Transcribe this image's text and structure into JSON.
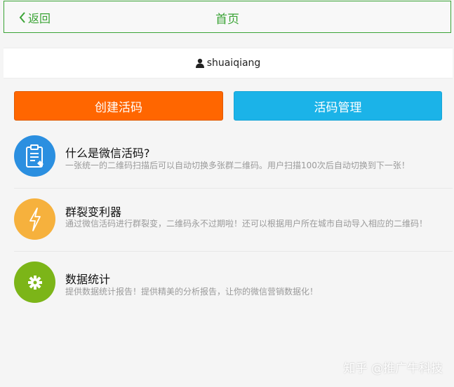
{
  "header": {
    "back_label": "返回",
    "title": "首页"
  },
  "user": {
    "username": "shuaiqiang"
  },
  "actions": {
    "create_label": "创建活码",
    "manage_label": "活码管理"
  },
  "features": [
    {
      "title": "什么是微信活码?",
      "description": "一张统一的二维码扫描后可以自动切换多张群二维码。用户扫描100次后自动切换到下一张！",
      "icon": "clipboard-icon",
      "color": "#2b8fe0"
    },
    {
      "title": "群裂变利器",
      "description": "通过微信活码进行群裂变，二维码永不过期啦！还可以根据用户所在城市自动导入相应的二维码！",
      "icon": "lightning-icon",
      "color": "#f6b13d"
    },
    {
      "title": "数据统计",
      "description": "提供数据统计报告！提供精美的分析报告，让你的微信营销数据化！",
      "icon": "gear-icon",
      "color": "#7cb518"
    }
  ],
  "watermark": "知乎 @推广牛科技"
}
